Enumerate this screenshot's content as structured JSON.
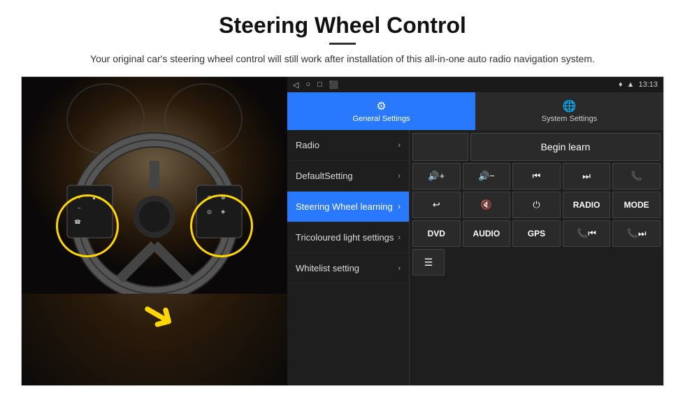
{
  "header": {
    "title": "Steering Wheel Control",
    "subtitle": "Your original car's steering wheel control will still work after installation of this all-in-one auto radio navigation system."
  },
  "statusBar": {
    "time": "13:13",
    "icons": [
      "◁",
      "○",
      "□",
      "⬛"
    ]
  },
  "navTabs": [
    {
      "id": "general",
      "label": "General Settings",
      "icon": "⚙",
      "active": true
    },
    {
      "id": "system",
      "label": "System Settings",
      "icon": "🌐",
      "active": false
    }
  ],
  "menuItems": [
    {
      "id": "radio",
      "label": "Radio",
      "active": false
    },
    {
      "id": "default-setting",
      "label": "DefaultSetting",
      "active": false
    },
    {
      "id": "steering-wheel",
      "label": "Steering Wheel learning",
      "active": true
    },
    {
      "id": "tricoloured",
      "label": "Tricoloured light settings",
      "active": false
    },
    {
      "id": "whitelist",
      "label": "Whitelist setting",
      "active": false
    }
  ],
  "controls": {
    "beginLearnLabel": "Begin learn",
    "row1": [
      "🔊+",
      "🔊−",
      "⏮",
      "⏭",
      "📞"
    ],
    "row2": [
      "↩",
      "🔇×",
      "⏻",
      "RADIO",
      "MODE"
    ],
    "row3": [
      "DVD",
      "AUDIO",
      "GPS",
      "📞⏮",
      "📞⏭"
    ]
  }
}
